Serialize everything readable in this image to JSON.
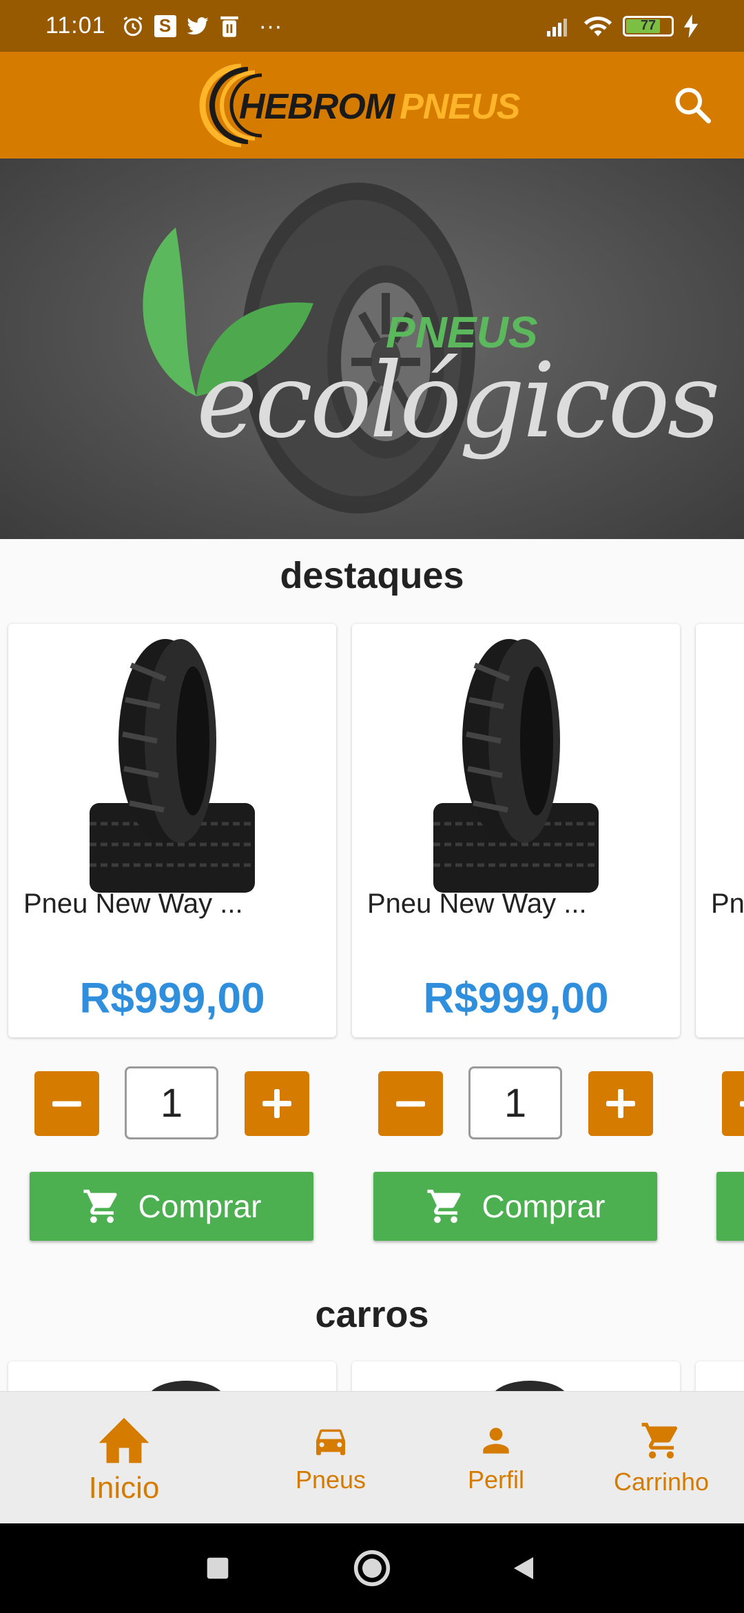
{
  "status_bar": {
    "time": "11:01",
    "left_icons": [
      "alarm-icon",
      "s-app-icon",
      "twitter-icon",
      "trash-icon",
      "more-icon"
    ],
    "s_letter": "S",
    "more": "···",
    "battery": "77"
  },
  "app_bar": {
    "logo_part1": "HEBROM",
    "logo_part2": "PNEUS"
  },
  "banner": {
    "word_small": "PNEUS",
    "word_large": "ecológicos"
  },
  "sections": {
    "featured_title": "destaques",
    "cars_title": "carros"
  },
  "products": [
    {
      "name": "Pneu New Way ...",
      "price": "R$999,00",
      "quantity": "1"
    },
    {
      "name": "Pneu New Way ...",
      "price": "R$999,00",
      "quantity": "1"
    },
    {
      "name": "Pn",
      "price": "",
      "quantity": ""
    }
  ],
  "buy_label": "Comprar",
  "bottom_nav": {
    "items": [
      {
        "label": "Inicio",
        "icon": "home-icon"
      },
      {
        "label": "Pneus",
        "icon": "car-icon"
      },
      {
        "label": "Perfil",
        "icon": "person-icon"
      },
      {
        "label": "Carrinho",
        "icon": "cart-icon"
      }
    ],
    "active": "Inicio"
  },
  "colors": {
    "brand_orange": "#d47b00",
    "status_bar": "#975a00",
    "buy_green": "#4caf50",
    "price_blue": "#2f8fdc"
  }
}
